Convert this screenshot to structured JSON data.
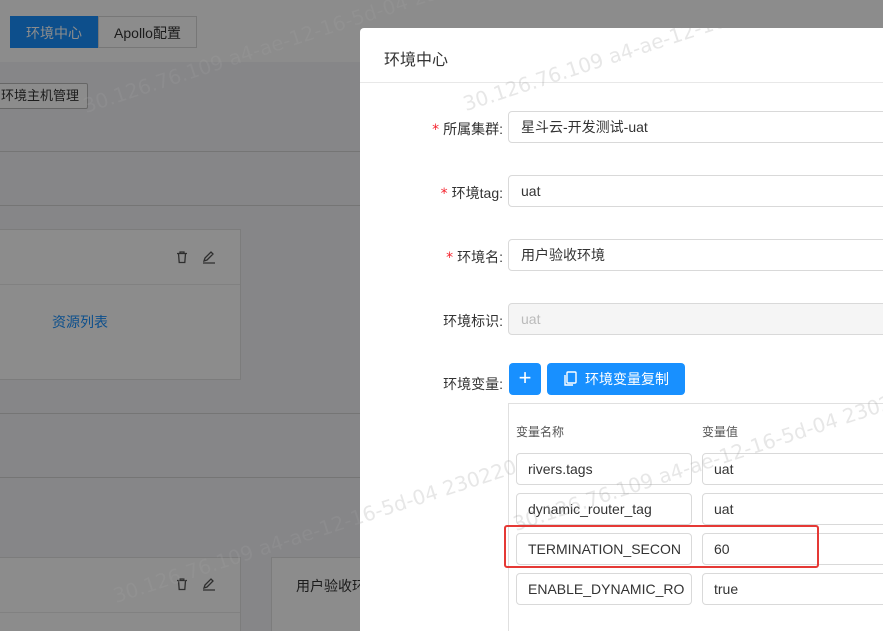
{
  "top_tabs": [
    {
      "label": "环境中心",
      "active": true
    },
    {
      "label": "Apollo配置",
      "active": false
    }
  ],
  "background": {
    "host_mgmt_button": "环境主机管理",
    "resource_link": "资源列表",
    "partial_card_title": "用户验收环"
  },
  "modal": {
    "title": "环境中心",
    "fields": {
      "cluster": {
        "label": "所属集群:",
        "value": "星斗云-开发测试-uat",
        "required": true
      },
      "env_tag": {
        "label": "环境tag:",
        "value": "uat",
        "required": true
      },
      "env_name": {
        "label": "环境名:",
        "value": "用户验收环境",
        "required": true
      },
      "env_id": {
        "label": "环境标识:",
        "value": "uat",
        "required": false,
        "disabled": true
      }
    },
    "env_vars": {
      "label": "环境变量:",
      "add_button": "+",
      "copy_button": "环境变量复制",
      "col_name": "变量名称",
      "col_value": "变量值",
      "rows": [
        {
          "name": "rivers.tags",
          "value": "uat"
        },
        {
          "name": "dynamic_router_tag",
          "value": "uat"
        },
        {
          "name": "TERMINATION_SECON",
          "value": "60"
        },
        {
          "name": "ENABLE_DYNAMIC_RO",
          "value": "true"
        }
      ]
    }
  },
  "watermark_text": "30.126.76.109 a4-ae-12-16-5d-04 230220",
  "colors": {
    "primary": "#1890ff",
    "required": "#f5222d",
    "highlight": "#e53935"
  }
}
